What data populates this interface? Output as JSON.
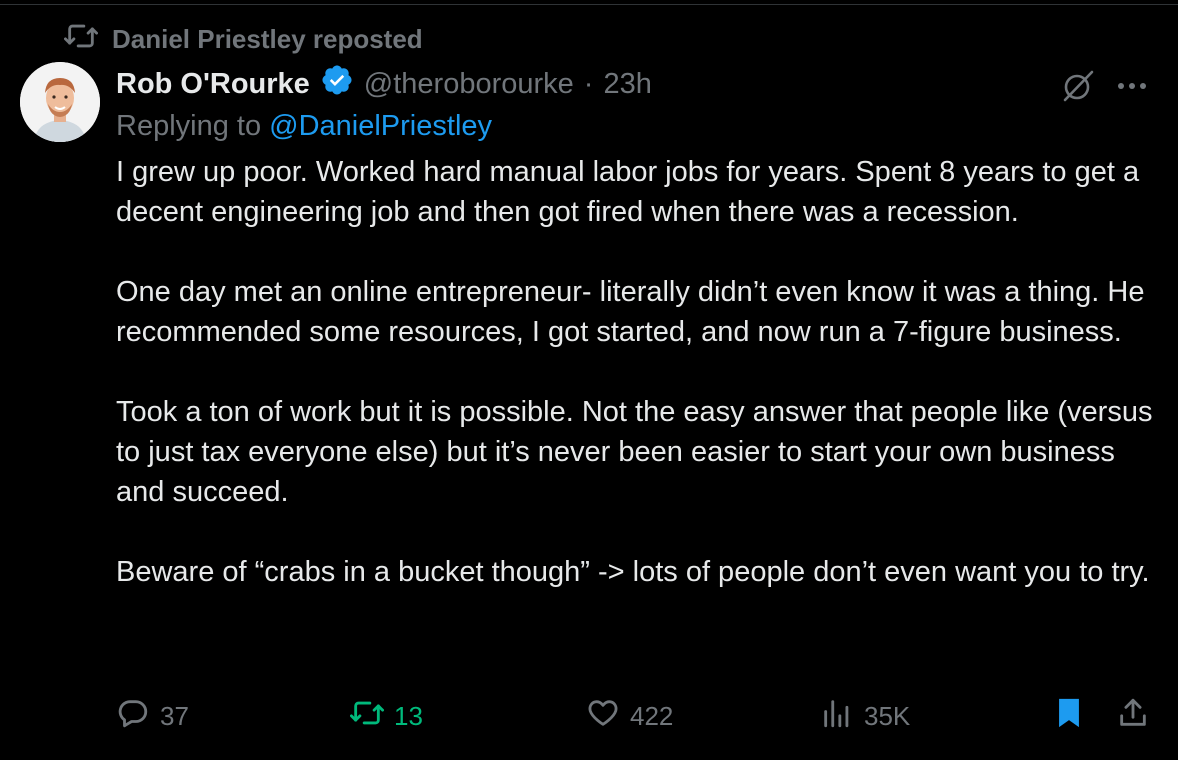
{
  "repost": {
    "text": "Daniel Priestley reposted",
    "icon": "repost-icon"
  },
  "author": {
    "name": "Rob O'Rourke",
    "handle": "@theroborourke",
    "separator": "·",
    "time": "23h",
    "verified": true
  },
  "reply": {
    "prefix": "Replying to",
    "mention": "@DanielPriestley"
  },
  "tweet": {
    "paragraphs": [
      "I grew up poor. Worked hard manual labor jobs for years. Spent 8 years to get a decent engineering job and then got fired when there was a recession.",
      "One day met an online entrepreneur- literally didn’t even know it was a thing. He recommended some resources, I got started, and now run a 7-figure business.",
      "Took a ton of work but it is possible. Not the easy answer that people like (versus to just tax everyone else) but it’s never been easier to start your own business and succeed.",
      "Beware of “crabs in a bucket though” -> lots of people don’t even want you to try."
    ]
  },
  "actions": {
    "replies": "37",
    "reposts": "13",
    "likes": "422",
    "views": "35K"
  },
  "colors": {
    "background": "#000000",
    "text": "#e7e9ea",
    "muted": "#71767b",
    "accent": "#1d9bf0",
    "repost_active": "#00ba7c"
  }
}
